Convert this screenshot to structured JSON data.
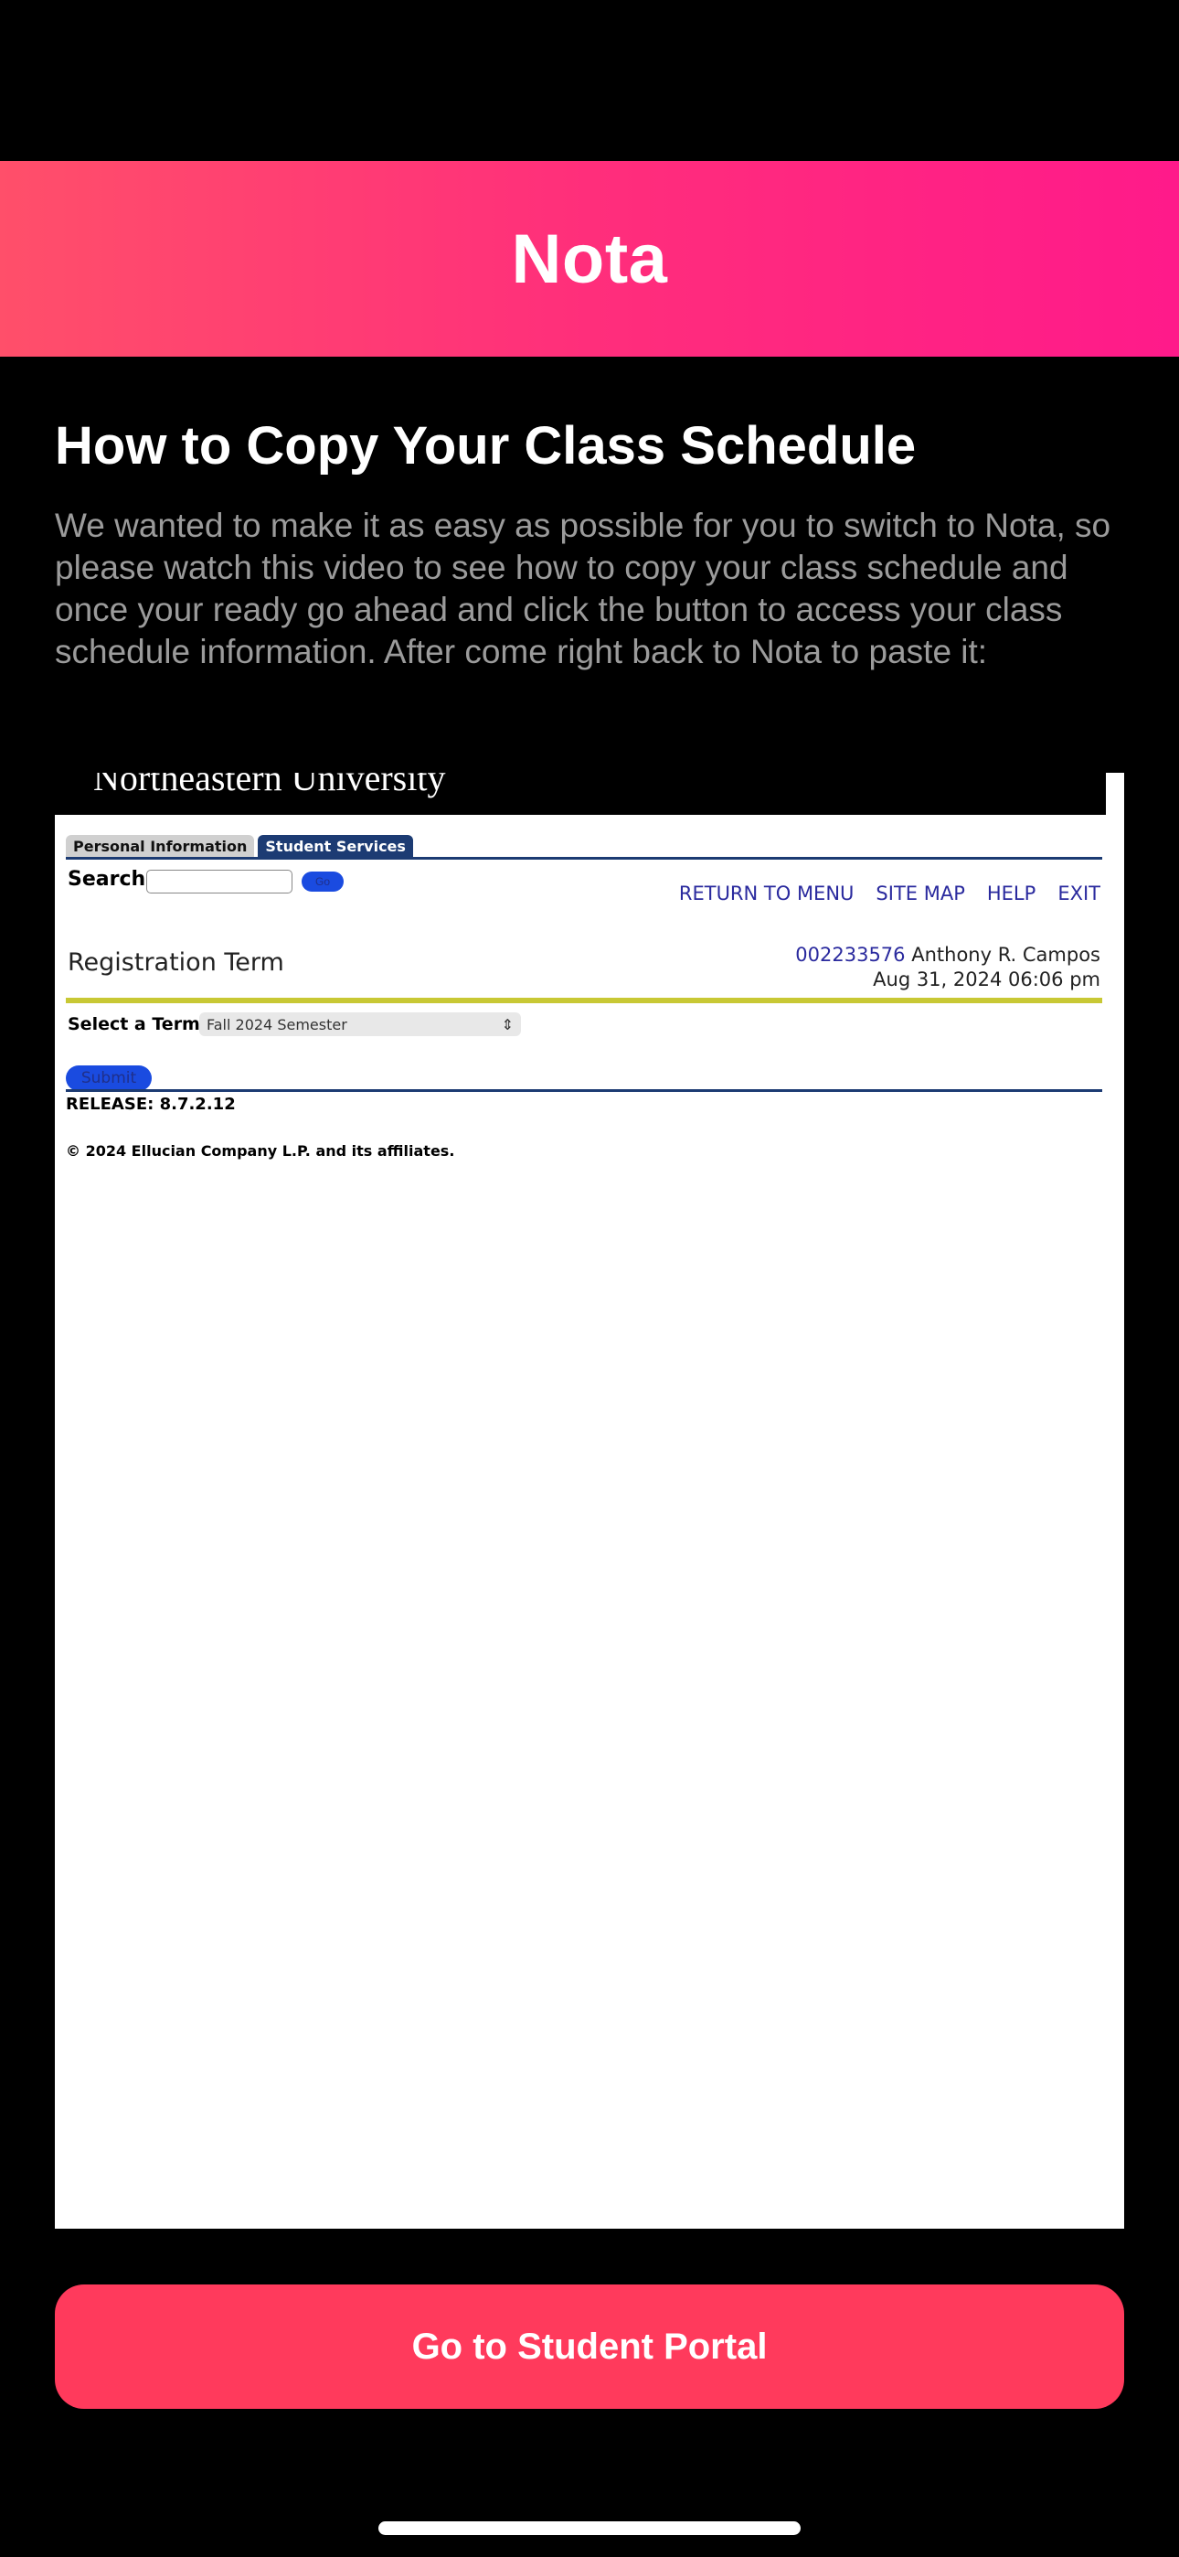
{
  "header": {
    "title": "Nota"
  },
  "main": {
    "title": "How to Copy Your Class Schedule",
    "intro": "We wanted to make it as easy as possible for you to switch to Nota, so please watch this video to see how to copy your class schedule and once your ready go ahead and click the button to access your class schedule information. After come right back to Nota to paste it:"
  },
  "video": {
    "banner_text": "Northeastern University",
    "tabs": [
      "Personal Information",
      "Student Services"
    ],
    "search_label": "Search",
    "go_label": "Go",
    "links": [
      "RETURN TO MENU",
      "SITE MAP",
      "HELP",
      "EXIT"
    ],
    "registration_title": "Registration Term",
    "student_id": "002233576",
    "student_name": "Anthony R. Campos",
    "datetime": "Aug 31, 2024 06:06 pm",
    "term_label": "Select a Term:",
    "term_value": "Fall 2024 Semester",
    "submit_label": "Submit",
    "release": "RELEASE: 8.7.2.12",
    "copyright": "© 2024 Ellucian Company L.P. and its affiliates."
  },
  "cta": {
    "label": "Go to Student Portal"
  },
  "colors": {
    "accent": "#ff3a5c",
    "header_start": "#ff4f6a",
    "header_end": "#ff1a8a"
  }
}
